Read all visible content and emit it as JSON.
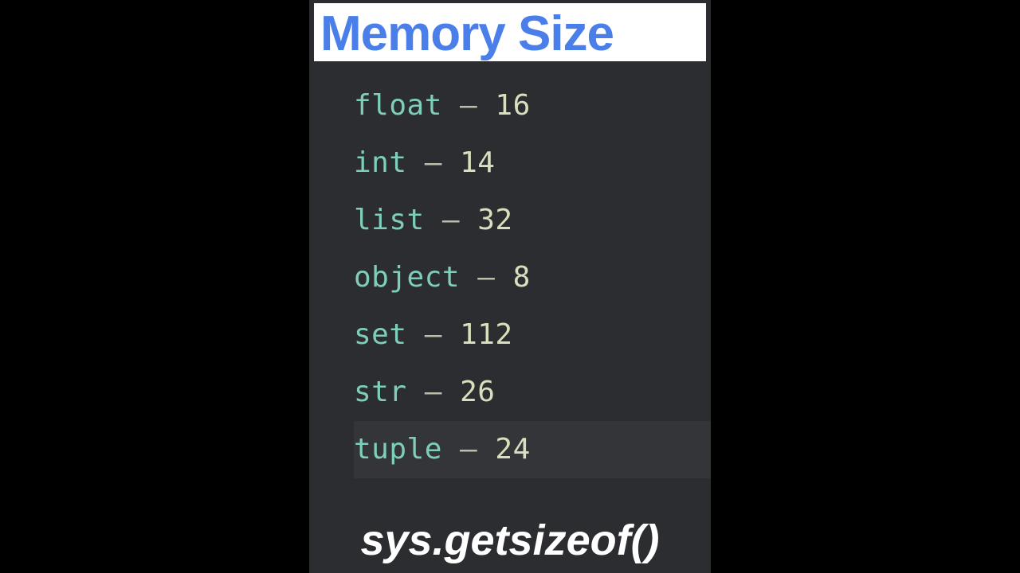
{
  "title": "Memory Size",
  "rows": [
    {
      "type": "float",
      "sep": " — ",
      "value": "16",
      "highlight": false
    },
    {
      "type": "int",
      "sep": " — ",
      "value": "14",
      "highlight": false
    },
    {
      "type": "list",
      "sep": " — ",
      "value": "32",
      "highlight": false
    },
    {
      "type": "object",
      "sep": " — ",
      "value": "8",
      "highlight": false
    },
    {
      "type": "set",
      "sep": " — ",
      "value": "112",
      "highlight": false
    },
    {
      "type": "str",
      "sep": " — ",
      "value": "26",
      "highlight": false
    },
    {
      "type": "tuple",
      "sep": " — ",
      "value": "24",
      "highlight": true
    }
  ],
  "subtitle": "sys.getsizeof()"
}
